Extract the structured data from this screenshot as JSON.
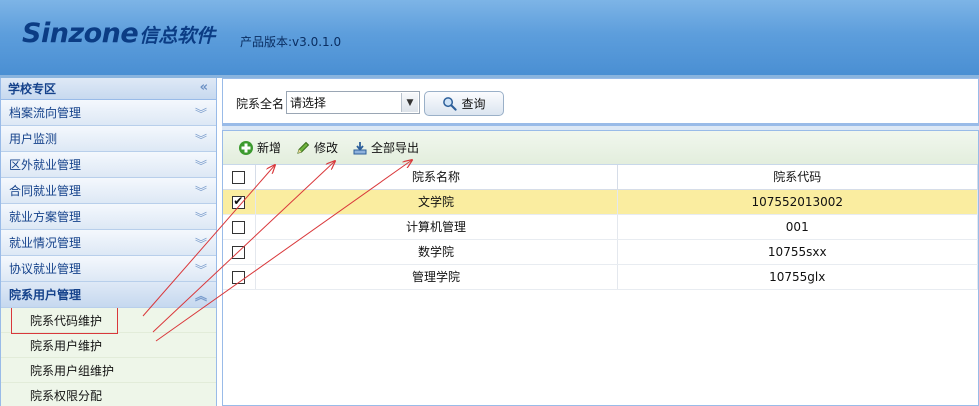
{
  "header": {
    "brand_en": "Sinzone",
    "brand_cn": "信总软件",
    "version": "产品版本:v3.0.1.0"
  },
  "sidebar": {
    "title": "学校专区",
    "collapse_icon": "double-chevron-left-icon",
    "items": [
      {
        "label": "档案流向管理"
      },
      {
        "label": "用户监测"
      },
      {
        "label": "区外就业管理"
      },
      {
        "label": "合同就业管理"
      },
      {
        "label": "就业方案管理"
      },
      {
        "label": "就业情况管理"
      },
      {
        "label": "协议就业管理"
      },
      {
        "label": "院系用户管理"
      }
    ],
    "subitems": [
      {
        "label": "院系代码维护"
      },
      {
        "label": "院系用户维护"
      },
      {
        "label": "院系用户组维护"
      },
      {
        "label": "院系权限分配"
      }
    ]
  },
  "search": {
    "label": "院系全名",
    "select_value": "请选择",
    "query_button": "查询"
  },
  "toolbar": {
    "add": "新增",
    "edit": "修改",
    "export_all": "全部导出"
  },
  "table": {
    "headers": [
      "院系名称",
      "院系代码"
    ],
    "rows": [
      {
        "name": "文学院",
        "code": "107552013002",
        "checked": true
      },
      {
        "name": "计算机管理",
        "code": "001",
        "checked": false
      },
      {
        "name": "数学院",
        "code": "10755sxx",
        "checked": false
      },
      {
        "name": "管理学院",
        "code": "10755glx",
        "checked": false
      }
    ]
  },
  "colors": {
    "header_blue": "#5d9edc",
    "selected_row": "#faeda0",
    "annotation_red": "#d9383b"
  }
}
